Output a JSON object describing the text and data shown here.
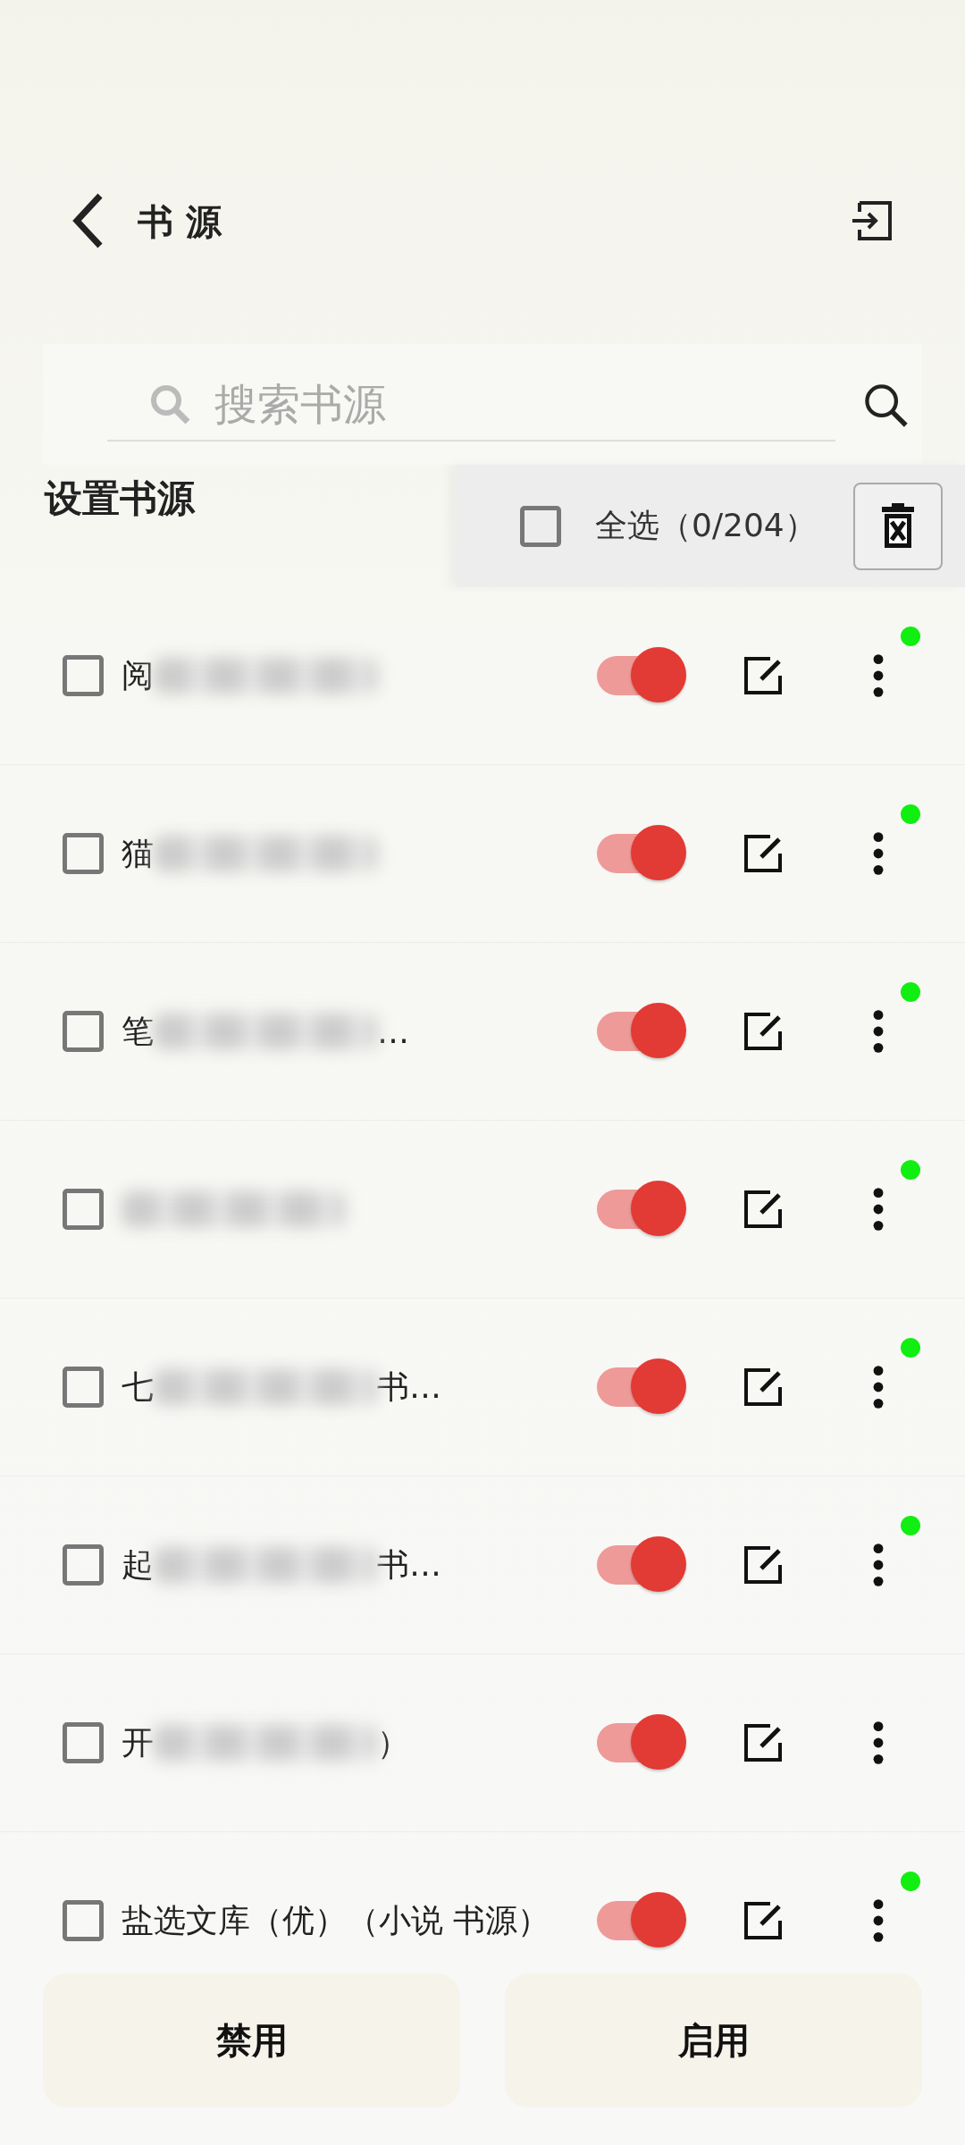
{
  "header": {
    "title": "书 源"
  },
  "search": {
    "placeholder": "搜索书源"
  },
  "section_title": "设置书源",
  "select_all": {
    "checked": false,
    "label": "全选（0/204）"
  },
  "sources": [
    {
      "lead": "阅",
      "blurred": true,
      "checked": false,
      "on": true,
      "online": true
    },
    {
      "lead": "猫",
      "blurred": true,
      "checked": false,
      "on": true,
      "online": true
    },
    {
      "lead": "笔",
      "tail": "…",
      "blurred": true,
      "checked": false,
      "on": true,
      "online": true
    },
    {
      "blurred": true,
      "checked": false,
      "on": true,
      "online": true
    },
    {
      "lead": "七",
      "tail": "书…",
      "blurred": true,
      "checked": false,
      "on": true,
      "online": true
    },
    {
      "lead": "起",
      "tail": "书…",
      "blurred": true,
      "checked": false,
      "on": true,
      "online": true
    },
    {
      "lead": "开",
      "tail": "）",
      "blurred": true,
      "checked": false,
      "on": true,
      "online": false
    },
    {
      "lead": "盐选文库（优）（小说 书源）",
      "blurred": false,
      "checked": false,
      "on": true,
      "online": true
    }
  ],
  "buttons": [
    {
      "label": "禁用"
    },
    {
      "label": "启用"
    }
  ]
}
